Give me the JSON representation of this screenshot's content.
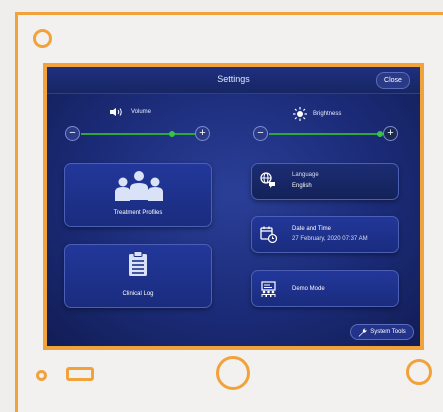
{
  "header": {
    "title": "Settings",
    "close_label": "Close"
  },
  "volume": {
    "label": "Volume",
    "level": 0.8,
    "minus": "−",
    "plus": "+"
  },
  "brightness": {
    "label": "Brightness",
    "level": 0.97,
    "minus": "−",
    "plus": "+"
  },
  "buttons": {
    "treatment_profiles": "Treatment Profiles",
    "clinical_log": "Clinical Log",
    "language_label": "Language",
    "language_value": "English",
    "datetime_label": "Date and Time",
    "datetime_value": "27 February, 2020 07:37 AM",
    "demo_mode": "Demo Mode",
    "system_tools": "System Tools"
  },
  "colors": {
    "frame": "#f2a23a",
    "screen_bg": "#1b2b78",
    "slider": "#2ea83a"
  },
  "icons": [
    "speaker-icon",
    "sun-icon",
    "people-icon",
    "clipboard-icon",
    "globe-chat-icon",
    "calendar-clock-icon",
    "presentation-icon",
    "wrench-icon"
  ]
}
